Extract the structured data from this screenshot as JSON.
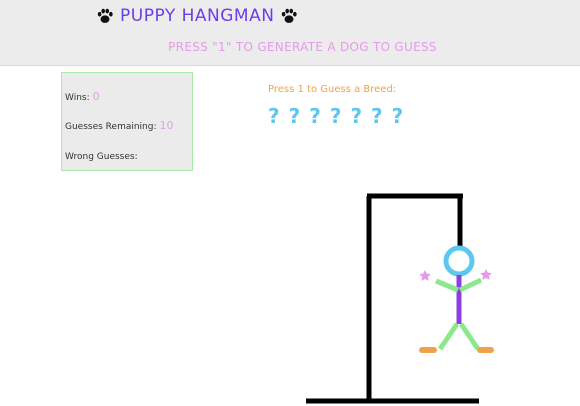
{
  "header": {
    "title": "PUPPY HANGMAN",
    "subtitle": "PRESS \"1\" TO GENERATE A DOG TO GUESS"
  },
  "stats": {
    "wins_label": "Wins:",
    "wins_value": "0",
    "guesses_label": "Guesses Remaining:",
    "guesses_value": "10",
    "wrong_label": "Wrong Guesses:",
    "wrong_value": ""
  },
  "game": {
    "prompt": "Press 1 to Guess a Breed:",
    "blanks": [
      "?",
      "?",
      "?",
      "?",
      "?",
      "?",
      "?"
    ]
  },
  "colors": {
    "title": "#6b3fe6",
    "subtitle": "#e59be9",
    "prompt": "#f0a24a",
    "blanks": "#5cc7ef",
    "head": "#5cc7ef",
    "body": "#8a3fe6",
    "limbs": "#8be98b",
    "hands": "#e59be9",
    "feet": "#f0a24a"
  },
  "icons": [
    "paw-icon-left",
    "paw-icon-right"
  ]
}
